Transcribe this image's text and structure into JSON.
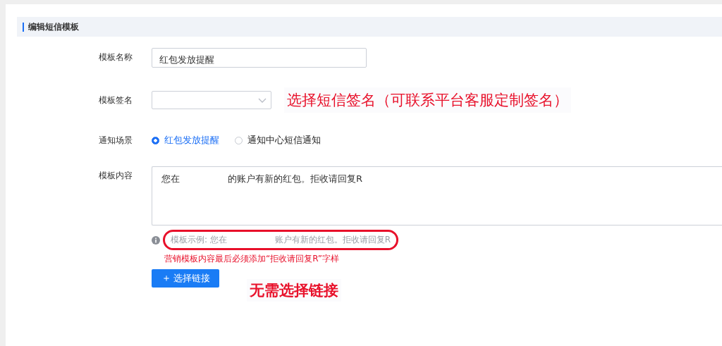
{
  "section_title": "编辑短信模板",
  "fields": [
    {
      "kind": "input",
      "label": "模板名称",
      "value": "红包发放提醒"
    },
    {
      "kind": "select",
      "label": "模板签名",
      "annotation": "选择短信签名（可联系平台客服定制签名）"
    },
    {
      "kind": "radio",
      "label": "通知场景",
      "options": [
        {
          "label": "红包发放提醒",
          "selected": true
        },
        {
          "label": "通知中心短信通知",
          "selected": false
        }
      ]
    },
    {
      "kind": "textarea",
      "label": "模板内容",
      "value_parts": [
        "您在",
        "的账户有新的红包。拒收请回复R"
      ],
      "example_parts": [
        "模板示例: 您在",
        "账户有新的红包。拒收请回复R"
      ],
      "warning": "营销模板内容最后必须添加“拒收请回复R”字样"
    }
  ],
  "link_button": {
    "icon": "＋",
    "label": "选择链接"
  },
  "link_annotation": "无需选择链接"
}
